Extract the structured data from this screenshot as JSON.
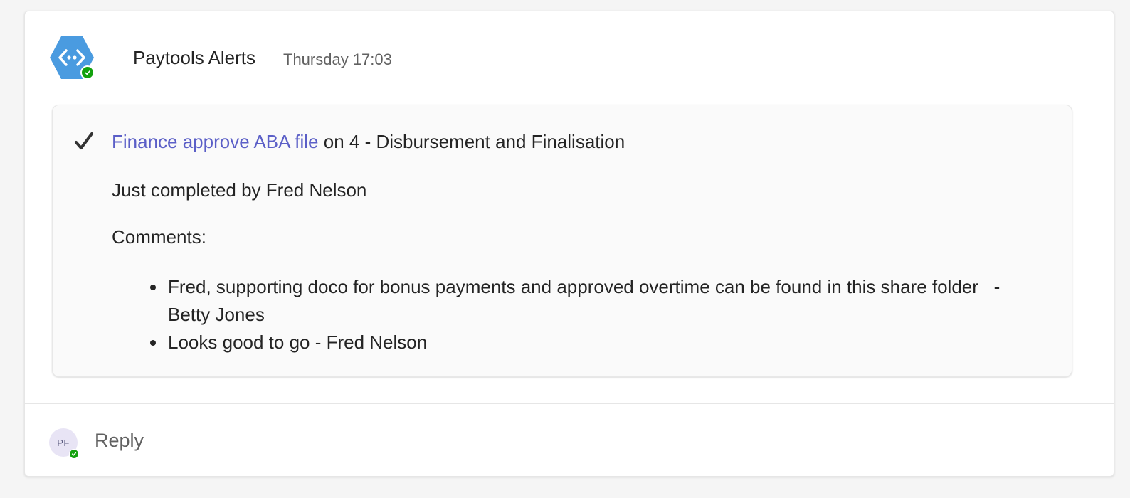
{
  "message": {
    "sender": "Paytools Alerts",
    "timestamp": "Thursday 17:03",
    "bot_avatar_icon": "connector-icon",
    "presence_icon": "available-check-icon"
  },
  "alert": {
    "status_icon": "check-icon",
    "task_link": "Finance approve ABA file",
    "task_suffix": " on 4 - Disbursement and Finalisation",
    "completed_by": "Just completed by Fred Nelson",
    "comments_label": "Comments:",
    "comments": [
      "Fred, supporting doco for bonus payments and approved overtime can be found in this share folder   - Betty Jones",
      "Looks good to go - Fred Nelson"
    ]
  },
  "footer": {
    "user_initials": "PF",
    "reply_label": "Reply"
  },
  "colors": {
    "accent_link": "#5b5fc7",
    "bot_avatar": "#4a9be0",
    "presence_available": "#13a10e"
  }
}
